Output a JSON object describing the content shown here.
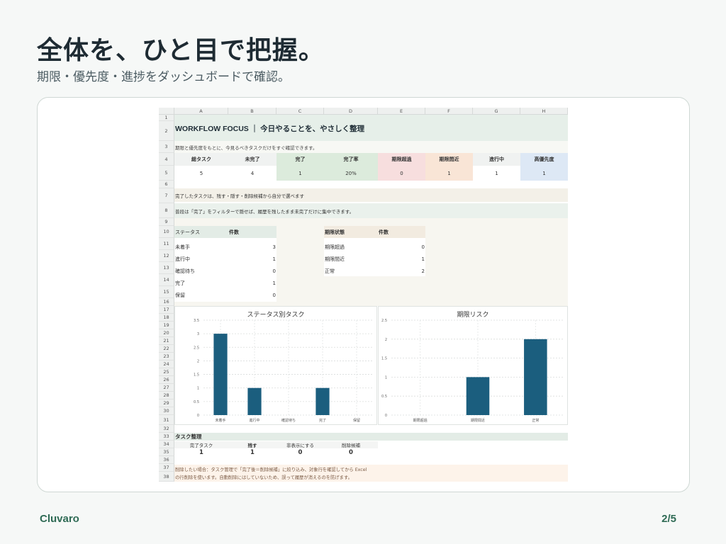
{
  "slide": {
    "title": "全体を、ひと目で把握。",
    "subtitle": "期限・優先度・進捗をダッシュボードで確認。",
    "brand": "Cluvaro",
    "page": "2/5"
  },
  "sheet": {
    "columns": [
      "A",
      "B",
      "C",
      "D",
      "E",
      "F",
      "G",
      "H"
    ],
    "rows": [
      "1",
      "2",
      "3",
      "4",
      "5",
      "6",
      "7",
      "8",
      "9",
      "10",
      "11",
      "12",
      "13",
      "14",
      "15",
      "16",
      "17",
      "18",
      "19",
      "20",
      "21",
      "22",
      "23",
      "24",
      "25",
      "26",
      "27",
      "28",
      "29",
      "30",
      "31",
      "32",
      "33",
      "34",
      "35",
      "36",
      "37",
      "38"
    ],
    "title": "WORKFLOW FOCUS ｜ 今日やることを、やさしく整理",
    "intro": "期限と優先度をもとに、今見るべきタスクだけをすぐ確認できます。",
    "kpi_labels": [
      "総タスク",
      "未完了",
      "完了",
      "完了率",
      "期限超過",
      "期限間近",
      "進行中",
      "高優先度"
    ],
    "kpi_values": [
      "5",
      "4",
      "1",
      "20%",
      "0",
      "1",
      "1",
      "1"
    ],
    "note1": "完了したタスクは、残す・隠す・削除候補から自分で選べます",
    "note2": "普段は「完了」をフィルターで隠せば、履歴を残したまま未完了だけに集中できます。",
    "status_table": {
      "header": [
        "ステータス",
        "件数"
      ],
      "rows": [
        [
          "未着手",
          "3"
        ],
        [
          "進行中",
          "1"
        ],
        [
          "確認待ち",
          "0"
        ],
        [
          "完了",
          "1"
        ],
        [
          "保留",
          "0"
        ]
      ]
    },
    "deadline_table": {
      "header": [
        "期限状態",
        "件数"
      ],
      "rows": [
        [
          "期限超過",
          "0"
        ],
        [
          "期限間近",
          "1"
        ],
        [
          "正常",
          "2"
        ]
      ]
    },
    "cleanup": {
      "title": "タスク整理",
      "labels": [
        "完了タスク",
        "残す",
        "非表示にする",
        "削除候補"
      ],
      "values": [
        "1",
        "1",
        "0",
        "0"
      ]
    },
    "footnote1": "削除したい場合：タスク管理で「完了後＝削除候補」に絞り込み、対象行を確認してから Excel",
    "footnote2": "の行削除を使います。自動削除にはしていないため、誤って履歴が消えるのを防げます。"
  },
  "chart_data": [
    {
      "type": "bar",
      "title": "ステータス別タスク",
      "categories": [
        "未着手",
        "進行中",
        "確認待ち",
        "完了",
        "保留"
      ],
      "values": [
        3,
        1,
        0,
        1,
        0
      ],
      "yticks": [
        "0",
        "0.5",
        "1",
        "1.5",
        "2",
        "2.5",
        "3",
        "3.5"
      ],
      "ylim": [
        0,
        3.5
      ],
      "grid": true,
      "color": "#1b5e7e"
    },
    {
      "type": "bar",
      "title": "期限リスク",
      "categories": [
        "期限超過",
        "期限間近",
        "正常"
      ],
      "values": [
        0,
        1,
        2
      ],
      "yticks": [
        "0",
        "0.5",
        "1",
        "1.5",
        "2",
        "2.5"
      ],
      "ylim": [
        0,
        2.5
      ],
      "grid": true,
      "color": "#1b5e7e"
    }
  ],
  "colors": {
    "title_band": "#e6efe9",
    "kpi_green": "#dcebdc",
    "kpi_red": "#f7dede",
    "kpi_orange": "#f9e5d6",
    "kpi_blue": "#dde8f5",
    "note_beige": "#f3f0e8",
    "note_green": "#eaf1ec",
    "table_header_green": "#e3ece6",
    "table_header_beige": "#f2ebe0",
    "footnote_bg": "#fdf3ea",
    "bar": "#1b5e7e"
  }
}
